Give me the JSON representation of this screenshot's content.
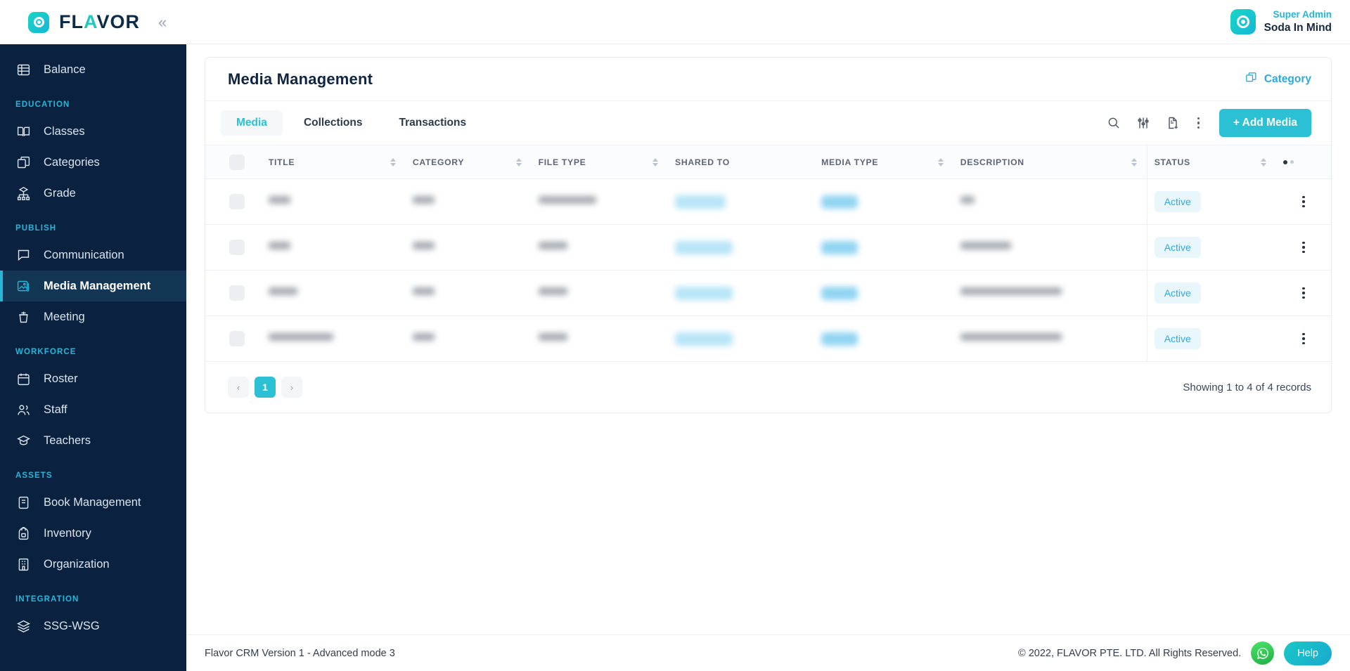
{
  "brand": {
    "logo_text_left": "FL",
    "logo_text_accent": "A",
    "logo_text_right": "VOR",
    "logo_full": "FLAVOR",
    "collapse_icon": "chevron-double-left-icon",
    "accent_color": "#2cc0d4",
    "sidebar_color": "#0a2240",
    "link_color": "#29abe2"
  },
  "sidebar": {
    "groups": [
      {
        "label": "",
        "items": [
          {
            "label": "Balance",
            "icon": "balance-icon",
            "active": false
          }
        ]
      },
      {
        "label": "EDUCATION",
        "items": [
          {
            "label": "Classes",
            "icon": "book-open-icon",
            "active": false
          },
          {
            "label": "Categories",
            "icon": "layers-box-icon",
            "active": false
          },
          {
            "label": "Grade",
            "icon": "hierarchy-icon",
            "active": false
          }
        ]
      },
      {
        "label": "PUBLISH",
        "items": [
          {
            "label": "Communication",
            "icon": "chat-bubble-icon",
            "active": false
          },
          {
            "label": "Media Management",
            "icon": "image-icon",
            "active": true
          },
          {
            "label": "Meeting",
            "icon": "podium-icon",
            "active": false
          }
        ]
      },
      {
        "label": "WORKFORCE",
        "items": [
          {
            "label": "Roster",
            "icon": "calendar-icon",
            "active": false
          },
          {
            "label": "Staff",
            "icon": "users-icon",
            "active": false
          },
          {
            "label": "Teachers",
            "icon": "graduation-cap-icon",
            "active": false
          }
        ]
      },
      {
        "label": "ASSETS",
        "items": [
          {
            "label": "Book Management",
            "icon": "book-icon",
            "active": false
          },
          {
            "label": "Inventory",
            "icon": "backpack-icon",
            "active": false
          },
          {
            "label": "Organization",
            "icon": "building-icon",
            "active": false
          }
        ]
      },
      {
        "label": "INTEGRATION",
        "items": [
          {
            "label": "SSG-WSG",
            "icon": "stack-icon",
            "active": false
          }
        ]
      }
    ]
  },
  "topbar": {
    "user_role": "Super Admin",
    "user_name": "Soda In Mind",
    "avatar_icon": "flavor-circle-avatar"
  },
  "card": {
    "title": "Media Management",
    "category_label": "Category",
    "category_icon": "copy-stack-icon"
  },
  "toolbar": {
    "tabs": [
      {
        "label": "Media",
        "active": true
      },
      {
        "label": "Collections",
        "active": false
      },
      {
        "label": "Transactions",
        "active": false
      }
    ],
    "icons": [
      {
        "name": "search-icon"
      },
      {
        "name": "filter-sliders-icon"
      },
      {
        "name": "document-add-icon"
      },
      {
        "name": "kebab-menu-icon"
      }
    ],
    "add_button_label": "+ Add Media"
  },
  "table": {
    "columns": [
      {
        "key": "checkbox",
        "label": "",
        "sortable": false
      },
      {
        "key": "title",
        "label": "TITLE",
        "sortable": true
      },
      {
        "key": "category",
        "label": "CATEGORY",
        "sortable": true
      },
      {
        "key": "file_type",
        "label": "FILE TYPE",
        "sortable": true
      },
      {
        "key": "shared_to",
        "label": "SHARED TO",
        "sortable": false
      },
      {
        "key": "media_type",
        "label": "MEDIA TYPE",
        "sortable": true
      },
      {
        "key": "description",
        "label": "DESCRIPTION",
        "sortable": true
      },
      {
        "key": "status",
        "label": "STATUS",
        "sortable": true
      },
      {
        "key": "actions",
        "label": "",
        "sortable": false
      }
    ],
    "rows": [
      {
        "title": "███",
        "category": "███",
        "file_type": "████████",
        "shared_to": "███████",
        "media_type": "█████",
        "description": "██",
        "status": "Active",
        "redacted": true
      },
      {
        "title": "███",
        "category": "███",
        "file_type": "████",
        "shared_to": "████████",
        "media_type": "█████",
        "description": "███████",
        "status": "Active",
        "redacted": true
      },
      {
        "title": "████",
        "category": "███",
        "file_type": "████",
        "shared_to": "████████",
        "media_type": "█████",
        "description": "██████████████",
        "status": "Active",
        "redacted": true
      },
      {
        "title": "█████████",
        "category": "███",
        "file_type": "████",
        "shared_to": "████████",
        "media_type": "█████",
        "description": "██████████████",
        "status": "Active",
        "redacted": true
      }
    ],
    "status_badge_bg": "#e9f7fd",
    "status_badge_color": "#29abe2"
  },
  "pagination": {
    "prev_label": "‹",
    "next_label": "›",
    "pages": [
      "1"
    ],
    "current_page": "1",
    "records_text": "Showing 1 to 4 of 4 records"
  },
  "footer": {
    "version_text": "Flavor CRM Version 1 - Advanced mode 3",
    "copyright": "© 2022, FLAVOR PTE. LTD. All Rights Reserved.",
    "whatsapp_icon": "whatsapp-icon",
    "help_label": "Help"
  },
  "annotation": {
    "arrow_color": "#e8202a",
    "points_to": "+ Add Media"
  }
}
